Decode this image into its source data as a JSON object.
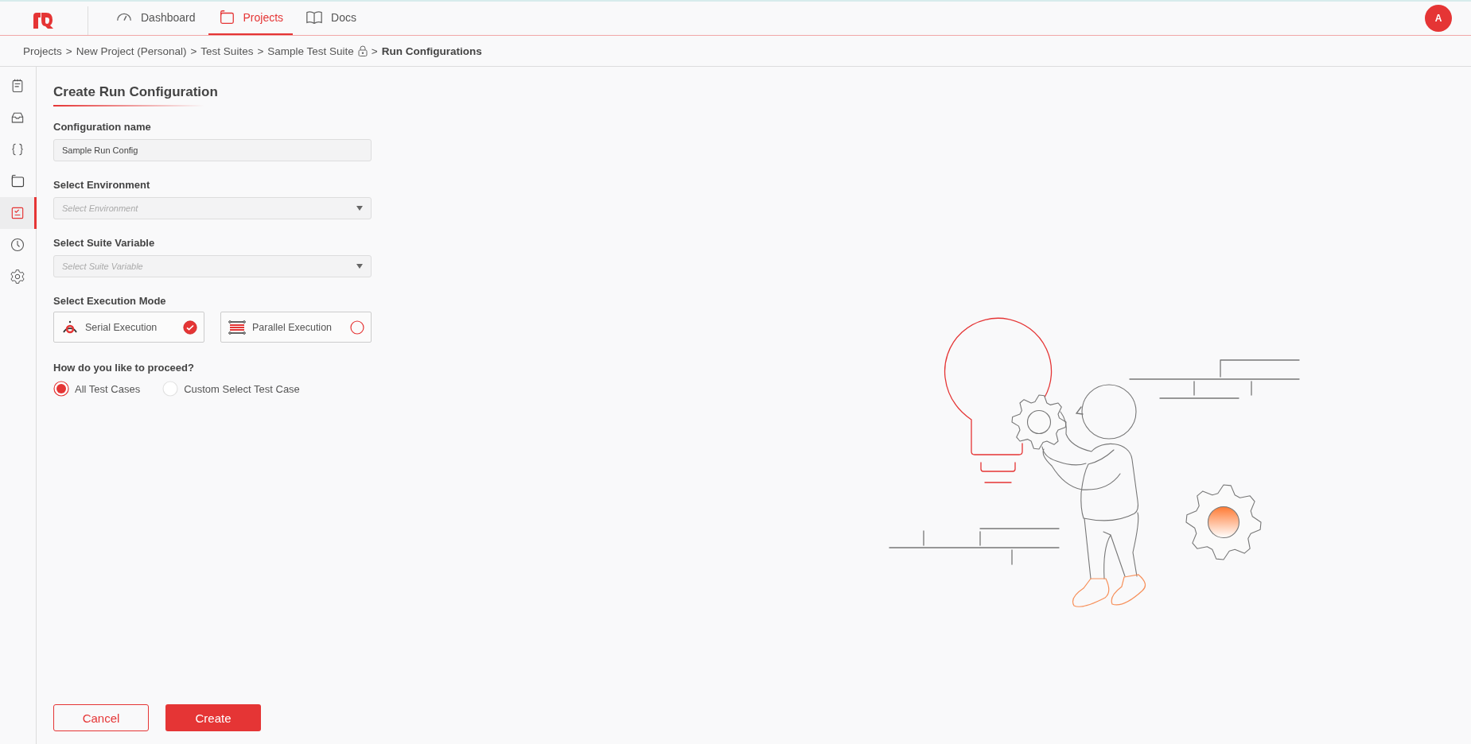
{
  "logo": {
    "kind": "rq"
  },
  "nav": [
    {
      "label": "Dashboard",
      "kind": "gauge",
      "selected": false
    },
    {
      "label": "Projects",
      "kind": "folder",
      "selected": true
    },
    {
      "label": "Docs",
      "kind": "book",
      "selected": false
    }
  ],
  "avatar": {
    "initial": "A"
  },
  "breadcrumb": [
    {
      "kind": "link",
      "label": "Projects"
    },
    {
      "kind": "separator",
      "label": ">"
    },
    {
      "kind": "link",
      "label": "New Project (Personal)"
    },
    {
      "kind": "separator",
      "label": ">"
    },
    {
      "kind": "link",
      "label": "Test Suites"
    },
    {
      "kind": "separator",
      "label": ">"
    },
    {
      "kind": "locked",
      "label": "Sample Test Suite"
    },
    {
      "kind": "separator",
      "label": ">"
    },
    {
      "kind": "current",
      "label": "Run Configurations"
    }
  ],
  "sidebar": {
    "items": [
      {
        "kind": "notes",
        "selected": false
      },
      {
        "kind": "inbox",
        "selected": false
      },
      {
        "kind": "braces",
        "selected": false
      },
      {
        "kind": "folder",
        "selected": false
      },
      {
        "kind": "checklist",
        "selected": true
      },
      {
        "kind": "clock",
        "selected": false
      },
      {
        "kind": "gear",
        "selected": false
      }
    ]
  },
  "form": {
    "title": "Create Run Configuration",
    "config_name": {
      "label": "Configuration name",
      "value": "Sample Run Config"
    },
    "environment": {
      "label": "Select Environment",
      "placeholder": "Select Environment"
    },
    "suite_variable": {
      "label": "Select Suite Variable",
      "placeholder": "Select Suite Variable"
    },
    "execution_mode": {
      "label": "Select Execution Mode",
      "options": [
        {
          "label": "Serial Execution",
          "kind": "serial",
          "selected": true
        },
        {
          "label": "Parallel Execution",
          "kind": "parallel",
          "selected": false
        }
      ]
    },
    "proceed": {
      "label": "How do you like to proceed?",
      "options": [
        {
          "label": "All Test Cases",
          "selected": true
        },
        {
          "label": "Custom Select Test Case",
          "selected": false
        }
      ]
    },
    "buttons": [
      {
        "kind": "secondary",
        "label": "Cancel"
      },
      {
        "kind": "primary",
        "label": "Create"
      }
    ]
  }
}
